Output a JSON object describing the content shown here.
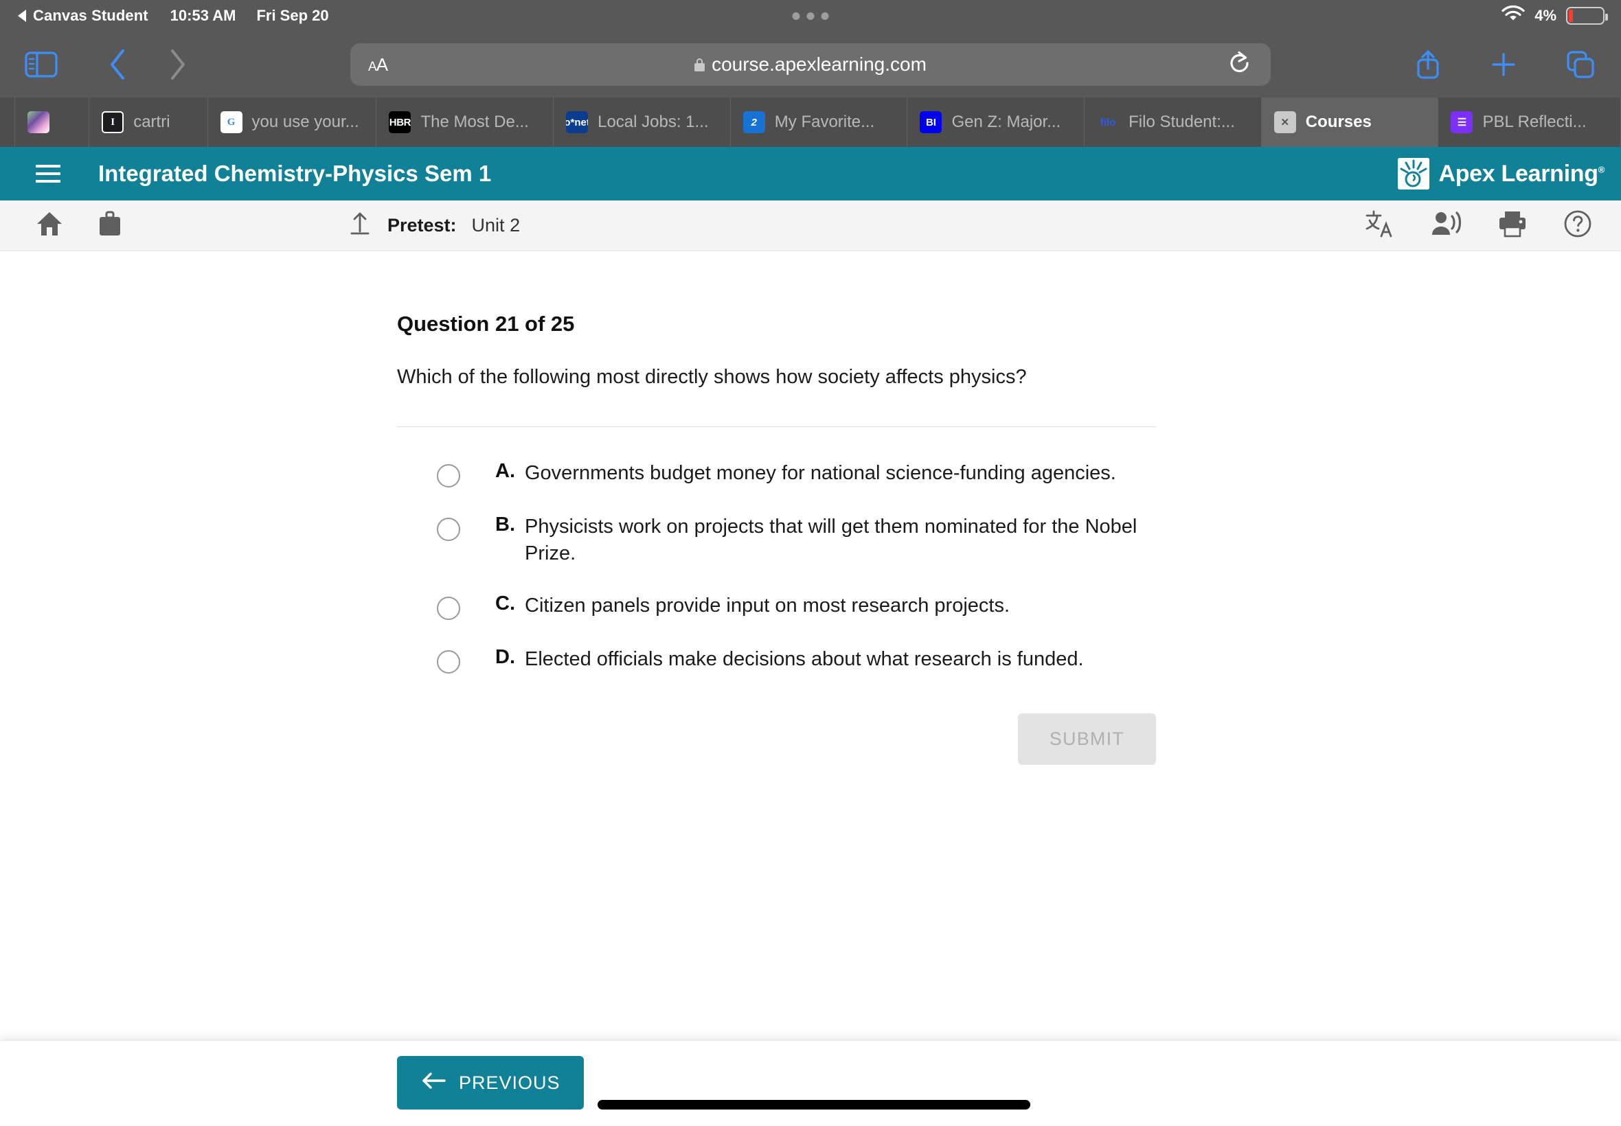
{
  "status_bar": {
    "back_app": "Canvas Student",
    "time": "10:53 AM",
    "date": "Fri Sep 20",
    "battery_percent": "4%"
  },
  "browser": {
    "text_size_label": "AA",
    "url": "course.apexlearning.com",
    "secure": true,
    "icons": {
      "sidebar": "sidebar-icon",
      "back": "chevron-left-icon",
      "forward": "chevron-right-icon",
      "reload": "reload-icon",
      "share": "share-icon",
      "new_tab": "plus-icon",
      "tabs": "tab-overview-icon"
    },
    "tabs": [
      {
        "label": "",
        "icon": "image-thumbnail-favicon",
        "active": false
      },
      {
        "label": "cartri",
        "icon": "instructure-favicon",
        "active": false
      },
      {
        "label": "you use your...",
        "icon": "google-favicon",
        "active": false
      },
      {
        "label": "The Most De...",
        "icon": "hbr-favicon",
        "active": false
      },
      {
        "label": "Local Jobs: 1...",
        "icon": "onet-favicon",
        "active": false
      },
      {
        "label": "My Favorite...",
        "icon": "blue-z-favicon",
        "active": false
      },
      {
        "label": "Gen Z: Major...",
        "icon": "business-insider-favicon",
        "active": false
      },
      {
        "label": "Filo Student:...",
        "icon": "filo-favicon",
        "active": false
      },
      {
        "label": "Courses",
        "icon": "broken-image-favicon",
        "active": true
      },
      {
        "label": "PBL Reflecti...",
        "icon": "purple-list-favicon",
        "active": false
      }
    ]
  },
  "course_header": {
    "menu_icon": "hamburger-menu-icon",
    "title": "Integrated Chemistry-Physics Sem 1",
    "brand_name": "Apex Learning",
    "brand_trademark": "®",
    "accent_color": "#118197"
  },
  "toolbar": {
    "home_icon": "home-icon",
    "briefcase_icon": "briefcase-icon",
    "upload_icon": "upload-arrow-icon",
    "pretest_label": "Pretest:",
    "pretest_value": "Unit 2",
    "translate_icon": "translate-icon",
    "read_aloud_icon": "read-aloud-icon",
    "print_icon": "print-icon",
    "help_icon": "help-icon"
  },
  "question": {
    "heading": "Question 21 of 25",
    "number": 21,
    "total": 25,
    "prompt": "Which of the following most directly shows how society affects physics?",
    "options": [
      {
        "letter": "A.",
        "text": "Governments budget money for national science-funding agencies.",
        "selected": false
      },
      {
        "letter": "B.",
        "text": "Physicists work on projects that will get them nominated for the Nobel Prize.",
        "selected": false
      },
      {
        "letter": "C.",
        "text": "Citizen panels provide input on most research projects.",
        "selected": false
      },
      {
        "letter": "D.",
        "text": "Elected officials make decisions about what research is funded.",
        "selected": false
      }
    ],
    "submit_label": "SUBMIT",
    "submit_enabled": false
  },
  "footer": {
    "previous_label": "PREVIOUS",
    "previous_icon": "arrow-left-icon"
  }
}
